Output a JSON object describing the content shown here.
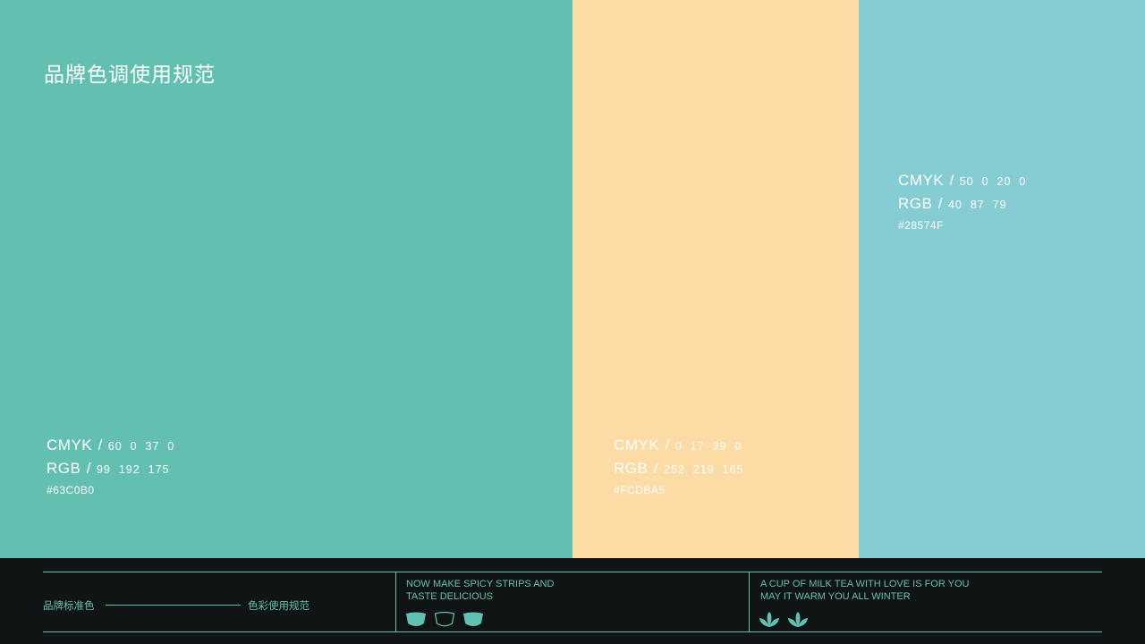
{
  "title": "品牌色调使用规范",
  "colors": [
    {
      "swatch": "#63C0B0",
      "cmyk_label": "CMYK",
      "cmyk": "60  0  37  0",
      "rgb_label": "RGB",
      "rgb": "99  192  175",
      "hex": "#63C0B0"
    },
    {
      "swatch": "#FCDBA5",
      "cmyk_label": "CMYK",
      "cmyk": "0  17  39  0",
      "rgb_label": "RGB",
      "rgb": "252  219  165",
      "hex": "#FCDBA5"
    },
    {
      "swatch": "#85CDD3",
      "cmyk_label": "CMYK",
      "cmyk": "50  0  20  0",
      "rgb_label": "RGB",
      "rgb": "40  87  79",
      "hex": "#28574F"
    }
  ],
  "separator": "/",
  "footer": {
    "left_label": "品牌标准色",
    "right_label": "色彩使用规范",
    "middle_line1": "NOW MAKE SPICY STRIPS AND",
    "middle_line2": "TASTE DELICIOUS",
    "right_line1": "A CUP OF MILK TEA WITH LOVE IS FOR YOU",
    "right_line2": "MAY IT WARM YOU ALL WINTER",
    "cup_icons": [
      "cup-filled-icon",
      "cup-outline-icon",
      "cup-filled-icon"
    ],
    "leaf_icons": [
      "leaf-icon",
      "leaf-icon"
    ],
    "accent": "#63C0B0",
    "background": "#111414"
  }
}
